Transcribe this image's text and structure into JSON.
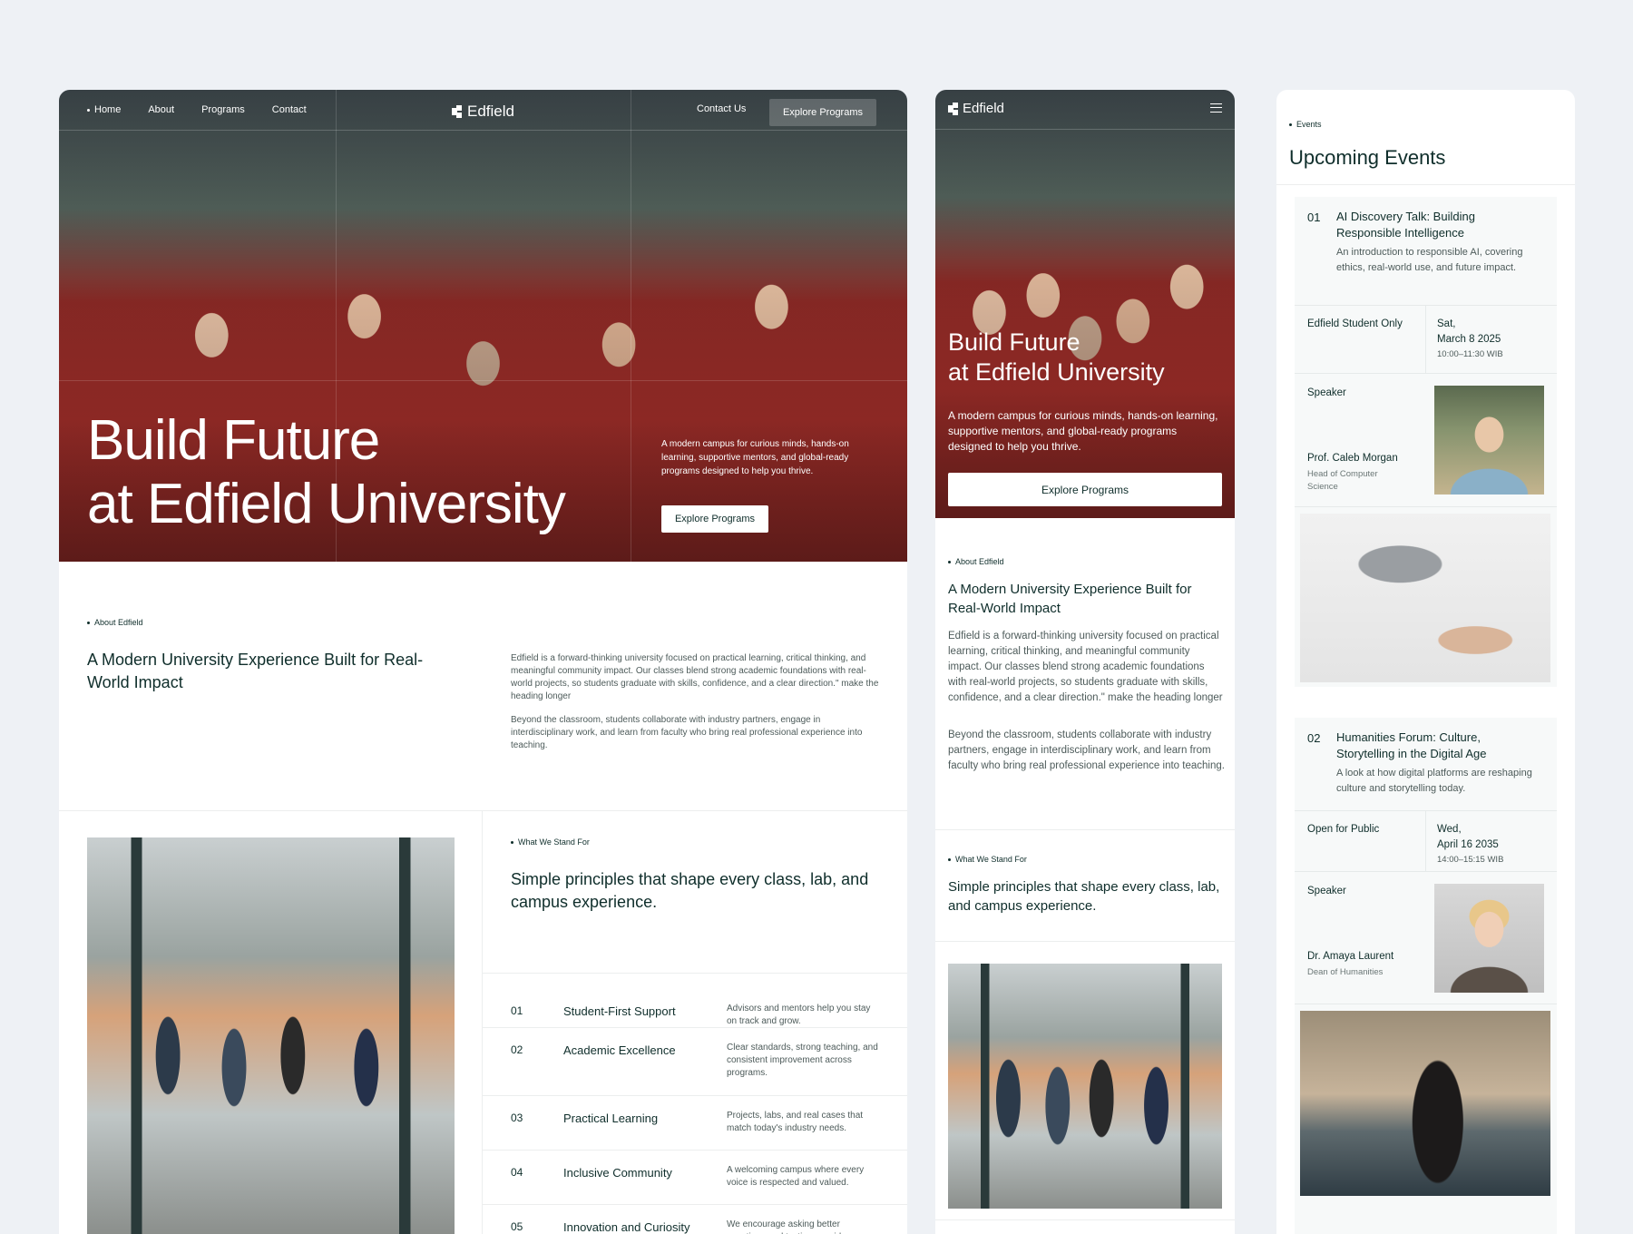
{
  "desktop": {
    "nav": {
      "links": [
        "Home",
        "About",
        "Programs",
        "Contact"
      ],
      "logo": "Edfield",
      "contact": "Contact Us",
      "explore": "Explore Programs"
    },
    "hero": {
      "title_line1": "Build Future",
      "title_line2": "at Edfield University",
      "subtitle": "A modern campus for curious minds, hands-on learning, supportive mentors, and global-ready programs designed to help you thrive.",
      "cta": "Explore Programs"
    },
    "about": {
      "tag": "About Edfield",
      "heading": "A Modern University Experience Built for Real-World Impact",
      "p1": "Edfield is a forward-thinking university focused on practical learning, critical thinking, and meaningful community impact. Our classes blend strong academic foundations with real-world projects, so students graduate with skills, confidence, and a clear direction.\" make the heading longer",
      "p2": "Beyond the classroom, students collaborate with industry partners, engage in interdisciplinary work, and learn from faculty who bring real professional experience into teaching."
    },
    "stand": {
      "tag": "What We Stand For",
      "heading": "Simple principles that shape every class, lab, and campus experience.",
      "principles": [
        {
          "num": "01",
          "title": "Student-First Support",
          "desc": "Advisors and mentors help you stay on track and grow."
        },
        {
          "num": "02",
          "title": "Academic Excellence",
          "desc": "Clear standards, strong teaching, and consistent improvement across programs."
        },
        {
          "num": "03",
          "title": "Practical Learning",
          "desc": "Projects, labs, and real cases that match today's industry needs."
        },
        {
          "num": "04",
          "title": "Inclusive Community",
          "desc": "A welcoming campus where every voice is respected and valued."
        },
        {
          "num": "05",
          "title": "Innovation and Curiosity",
          "desc": "We encourage asking better questions and testing new ideas."
        }
      ]
    }
  },
  "mobile": {
    "logo": "Edfield",
    "hero": {
      "title_line1": "Build Future",
      "title_line2": "at Edfield University",
      "subtitle": "A modern campus for curious minds, hands-on learning, supportive mentors, and global-ready programs designed to help you thrive.",
      "cta": "Explore Programs"
    },
    "about": {
      "tag": "About Edfield",
      "heading": "A Modern University Experience Built for Real-World Impact",
      "p1": "Edfield is a forward-thinking university focused on practical learning, critical thinking, and meaningful community impact. Our classes blend strong academic foundations with real-world projects, so students graduate with skills, confidence, and a clear direction.\" make the heading longer",
      "p2": "Beyond the classroom, students collaborate with industry partners, engage in interdisciplinary work, and learn from faculty who bring real professional experience into teaching."
    },
    "stand": {
      "tag": "What We Stand For",
      "heading": "Simple principles that shape every class, lab, and campus experience."
    }
  },
  "events": {
    "tag": "Events",
    "heading": "Upcoming Events",
    "items": [
      {
        "num": "01",
        "title": "AI Discovery Talk: Building Responsible Intelligence",
        "desc": "An introduction to responsible AI, covering ethics, real-world use, and future impact.",
        "audience": "Edfield Student Only",
        "day": "Sat,",
        "date": "March 8 2025",
        "time": "10:00–11:30 WIB",
        "speaker_label": "Speaker",
        "speaker_name": "Prof. Caleb Morgan",
        "speaker_role": "Head of Computer Science"
      },
      {
        "num": "02",
        "title": "Humanities Forum: Culture, Storytelling in the Digital Age",
        "desc": "A look at how digital platforms are reshaping culture and storytelling today.",
        "audience": "Open for Public",
        "day": "Wed,",
        "date": "April 16 2035",
        "time": "14:00–15:15 WIB",
        "speaker_label": "Speaker",
        "speaker_name": "Dr. Amaya Laurent",
        "speaker_role": "Dean of Humanities"
      }
    ]
  },
  "icons": [
    "logo-mark-icon",
    "menu-icon",
    "bullet-dot-icon"
  ],
  "colors": {
    "accent": "#0f2e2b",
    "page_bg": "#eef1f5",
    "hero_red": "#a8302b"
  }
}
